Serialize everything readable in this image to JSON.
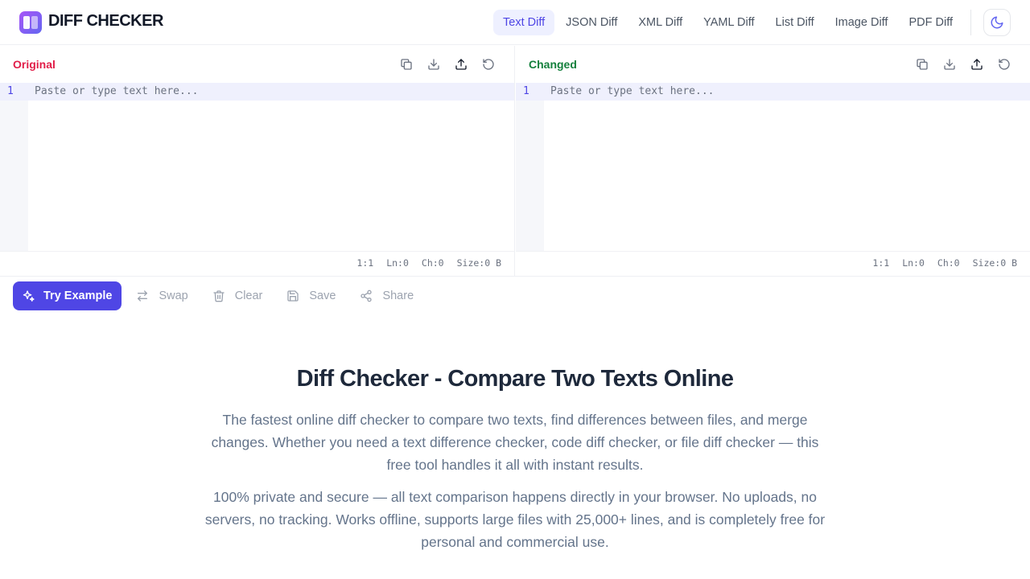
{
  "brand": {
    "name": "DIFF CHECKER"
  },
  "nav": {
    "tabs": [
      {
        "label": "Text Diff",
        "active": true
      },
      {
        "label": "JSON Diff"
      },
      {
        "label": "XML Diff"
      },
      {
        "label": "YAML Diff"
      },
      {
        "label": "List Diff"
      },
      {
        "label": "Image Diff"
      },
      {
        "label": "PDF Diff"
      }
    ],
    "theme_icon": "moon-icon"
  },
  "panes": {
    "original": {
      "title": "Original",
      "line_number": "1",
      "placeholder": "Paste or type text here...",
      "status": {
        "position": "1:1",
        "lines": "Ln:0",
        "chars": "Ch:0",
        "size": "Size:0 B"
      }
    },
    "changed": {
      "title": "Changed",
      "line_number": "1",
      "placeholder": "Paste or type text here...",
      "status": {
        "position": "1:1",
        "lines": "Ln:0",
        "chars": "Ch:0",
        "size": "Size:0 B"
      }
    },
    "tool_icons": [
      "copy-icon",
      "download-icon",
      "upload-icon",
      "reset-icon"
    ]
  },
  "actions": {
    "try_example": "Try Example",
    "swap": "Swap",
    "clear": "Clear",
    "save": "Save",
    "share": "Share"
  },
  "hero": {
    "title": "Diff Checker - Compare Two Texts Online",
    "para1": "The fastest online diff checker to compare two texts, find differences between files, and merge changes. Whether you need a text difference checker, code diff checker, or file diff checker — this free tool handles it all with instant results.",
    "para2": "100% private and secure — all text comparison happens directly in your browser. No uploads, no servers, no tracking. Works offline, supports large files with 25,000+ lines, and is completely free for personal and commercial use."
  },
  "colors": {
    "accent": "#4f46e5",
    "original": "#e11d48",
    "changed": "#15803d"
  }
}
